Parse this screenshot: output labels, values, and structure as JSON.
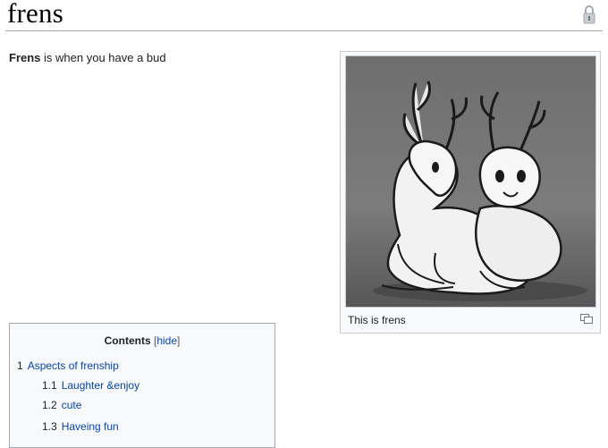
{
  "page": {
    "title": "frens"
  },
  "intro": {
    "bold_term": "Frens",
    "text": " is when you have a bud"
  },
  "thumbnail": {
    "caption": "This is frens",
    "icons": [
      "magnify-clip-icon"
    ]
  },
  "toc": {
    "title": "Contents",
    "bracket_open": "[",
    "hide_label": "hide",
    "bracket_close": "]",
    "items": [
      {
        "number": "1",
        "label": "Aspects of frenship"
      },
      {
        "number": "1.1",
        "label": "Laughter &enjoy"
      },
      {
        "number": "1.2",
        "label": "cute"
      },
      {
        "number": "1.3",
        "label": "Haveing fun"
      }
    ]
  },
  "header": {
    "icons": [
      "lock-icon"
    ]
  },
  "colors": {
    "link": "#0645ad",
    "border": "#a2a9b1",
    "panel_bg": "#f8f9fa"
  }
}
